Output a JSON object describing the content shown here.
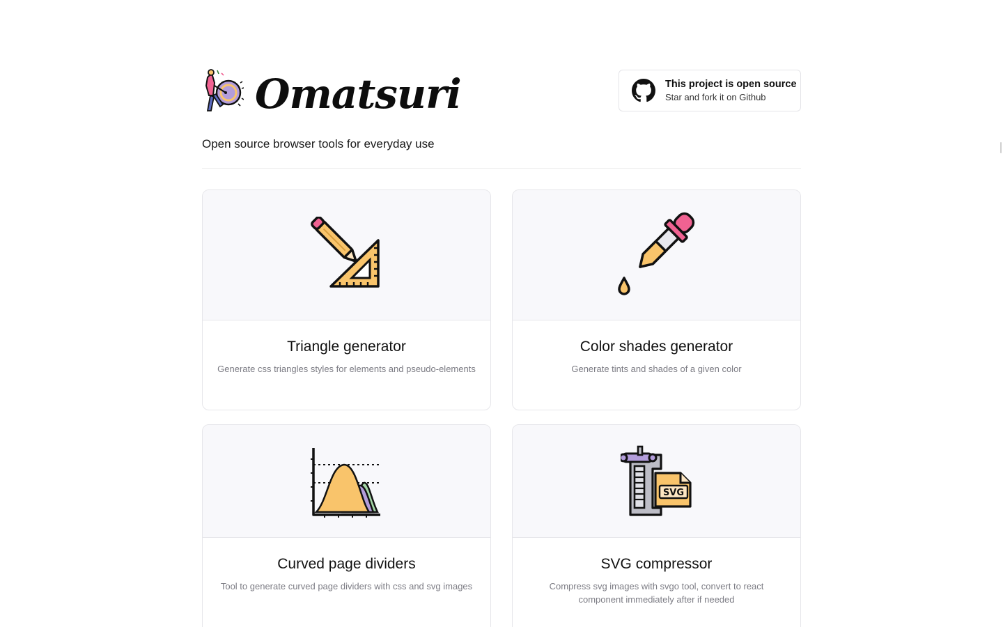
{
  "brand": {
    "name": "Omatsuri",
    "tagline": "Open source browser tools for everyday use"
  },
  "github": {
    "title": "This project is open source",
    "subtitle": "Star and fork it on Github",
    "icon": "github-icon"
  },
  "tools": [
    {
      "title": "Triangle generator",
      "description": "Generate css triangles styles for elements and pseudo-elements",
      "icon": "pencil-set-square-icon"
    },
    {
      "title": "Color shades generator",
      "description": "Generate tints and shades of a given color",
      "icon": "eyedropper-icon"
    },
    {
      "title": "Curved page dividers",
      "description": "Tool to generate curved page dividers with css and svg images",
      "icon": "bell-curve-chart-icon"
    },
    {
      "title": "SVG compressor",
      "description": "Compress svg images with svgo tool, convert to react component immediately after if needed",
      "icon": "svg-clamp-icon",
      "icon_label": "SVG"
    }
  ],
  "colors": {
    "accent_yellow": "#f9c46b",
    "accent_pink": "#f06292",
    "accent_purple": "#b39ddb",
    "accent_green": "#a5d6a7",
    "card_thumb_bg": "#f8f8fb",
    "description_gray": "#7c7c84"
  }
}
